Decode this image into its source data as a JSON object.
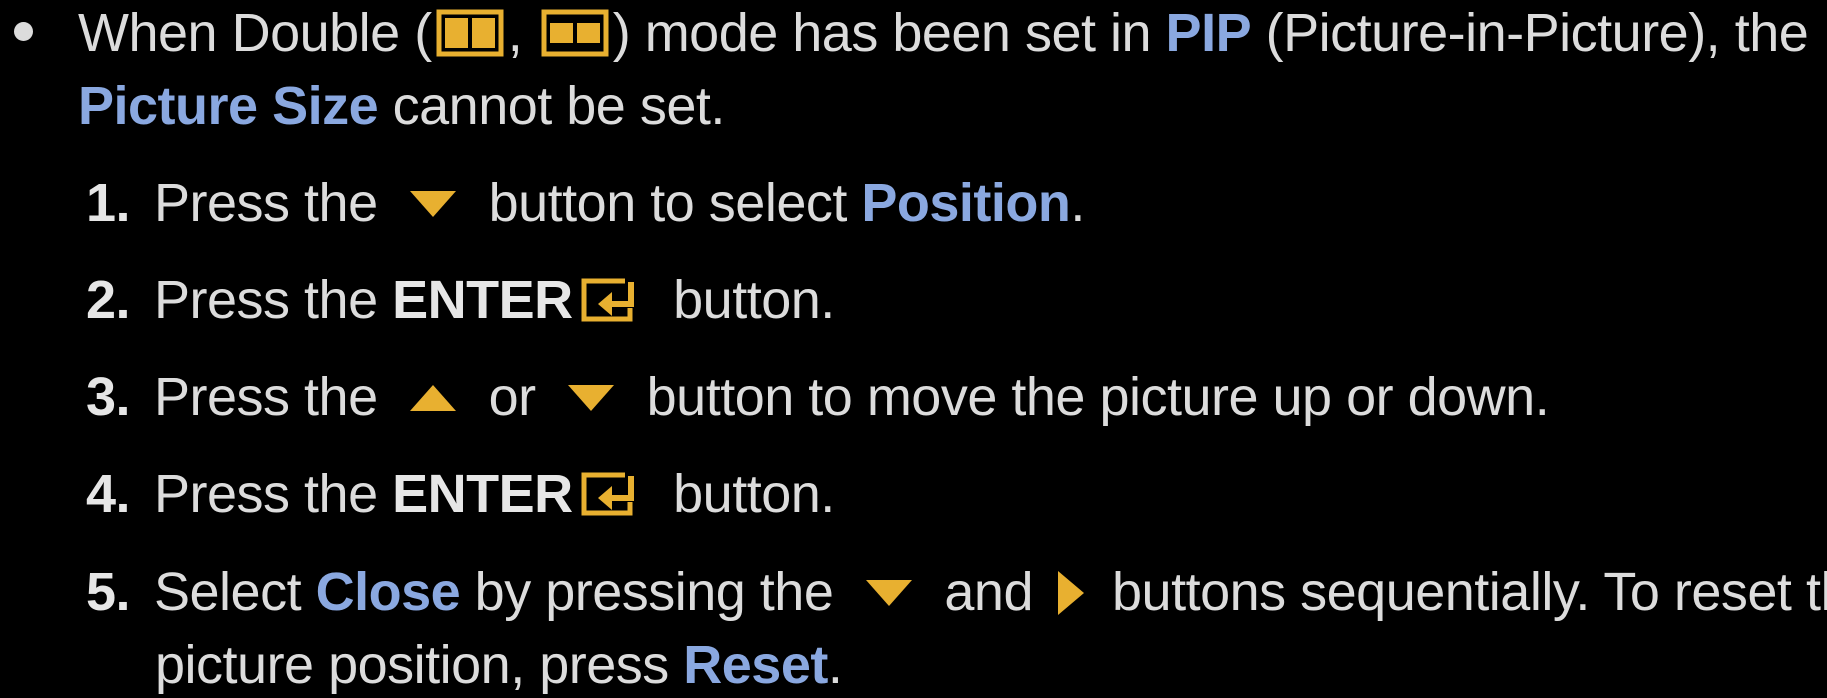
{
  "colors": {
    "background": "#000000",
    "text": "#dcdcdc",
    "highlight": "#8aa8e0",
    "icon": "#e8b030"
  },
  "bullet": {
    "t1": "When Double (",
    "t2": ", ",
    "t3": ") mode has been set in ",
    "pip": "PIP",
    "t4": " (Picture-in-Picture), the",
    "picture_size": "Picture Size",
    "t5": " cannot be set."
  },
  "steps": [
    {
      "num": "1.",
      "a": "Press the ",
      "b": " button to select ",
      "hl": "Position",
      "c": "."
    },
    {
      "num": "2.",
      "a": "Press the ",
      "bold": "ENTER",
      "c": " button."
    },
    {
      "num": "3.",
      "a": "Press the ",
      "b": " or ",
      "c": " button to move the picture up or down."
    },
    {
      "num": "4.",
      "a": "Press the ",
      "bold": "ENTER",
      "c": " button."
    },
    {
      "num": "5.",
      "a": "Select ",
      "hl": "Close",
      "b": " by pressing the ",
      "c": " and ",
      "d": " buttons sequentially. To reset the",
      "line2a": "picture position, press ",
      "hl2": "Reset",
      "line2b": "."
    }
  ],
  "icons": {
    "double_a": "double-screen-icon",
    "double_b": "double-screen-alt-icon",
    "down": "down-arrow-icon",
    "up": "up-arrow-icon",
    "right": "right-arrow-icon",
    "enter": "enter-icon"
  }
}
